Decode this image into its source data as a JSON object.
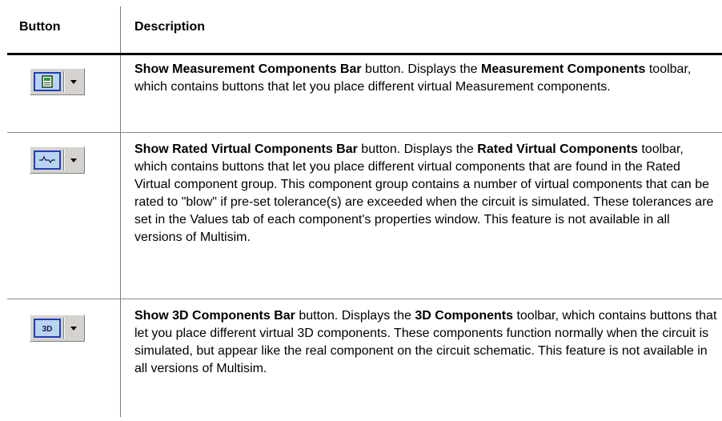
{
  "header": {
    "button": "Button",
    "description": "Description"
  },
  "rows": [
    {
      "icon": "measurement-components-icon",
      "parts": [
        {
          "t": "Show Measurement Components Bar",
          "b": true
        },
        {
          "t": " button. Displays the ",
          "b": false
        },
        {
          "t": "Measurement Components",
          "b": true
        },
        {
          "t": " toolbar, which contains buttons that let you place different virtual Measurement components.",
          "b": false
        }
      ]
    },
    {
      "icon": "rated-virtual-components-icon",
      "parts": [
        {
          "t": "Show Rated Virtual Components Bar",
          "b": true
        },
        {
          "t": " button. Displays the ",
          "b": false
        },
        {
          "t": "Rated Virtual Components",
          "b": true
        },
        {
          "t": " toolbar, which contains buttons that let you place different virtual components that are found in the Rated Virtual component group. This component group contains a number of virtual components that can be rated to \"blow\" if pre-set tolerance(s) are exceeded when the circuit is simulated. These tolerances are set in the Values tab of each component's properties window. This feature is not available in all versions of Multisim.",
          "b": false
        }
      ]
    },
    {
      "icon": "3d-components-icon",
      "icon_text": "3D",
      "parts": [
        {
          "t": "Show 3D Components Bar",
          "b": true
        },
        {
          "t": " button. Displays the ",
          "b": false
        },
        {
          "t": "3D Components",
          "b": true
        },
        {
          "t": " toolbar, which contains buttons that let you place different virtual 3D components. These components function normally when the circuit is simulated, but appear like the real component on the circuit schematic. This feature is not available in all versions of Multisim.",
          "b": false
        }
      ]
    }
  ]
}
